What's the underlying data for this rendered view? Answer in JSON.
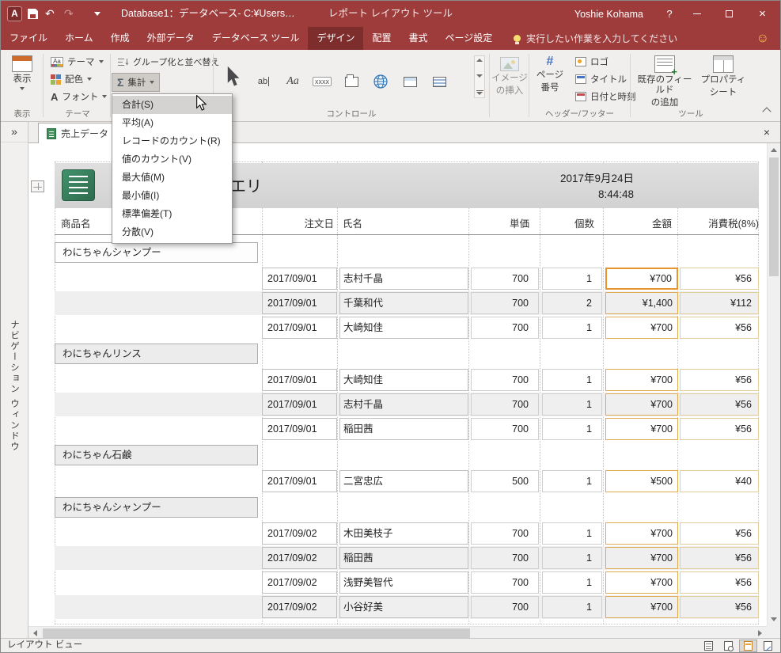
{
  "titlebar": {
    "app_title": "Database1：データベース- C:¥Users…",
    "context_title": "レポート レイアウト ツール",
    "user_name": "Yoshie Kohama",
    "help_label": "?"
  },
  "tabs": {
    "items": [
      {
        "label": "ファイル"
      },
      {
        "label": "ホーム"
      },
      {
        "label": "作成"
      },
      {
        "label": "外部データ"
      },
      {
        "label": "データベース ツール"
      },
      {
        "label": "デザイン",
        "active": true
      },
      {
        "label": "配置"
      },
      {
        "label": "書式"
      },
      {
        "label": "ページ設定"
      }
    ],
    "tell_me": "実行したい作業を入力してください"
  },
  "ribbon": {
    "view_button": "表示",
    "view_group_label": "表示",
    "theme_button": "テーマ",
    "colors_button": "配色",
    "fonts_button": "フォント",
    "theme_group_label": "テーマ",
    "group_sort_button": "グループ化と並べ替え",
    "totals_button": "集計",
    "controls_group_label": "コントロール",
    "image_line1": "イメージ",
    "image_line2": "の挿入",
    "page_number_line1": "ページ",
    "page_number_line2": "番号",
    "logo_button": "ロゴ",
    "title_button": "タイトル",
    "datetime_button": "日付と時刻",
    "header_footer_group_label": "ヘッダー/フッター",
    "add_fields_line1": "既存のフィールド",
    "add_fields_line2": "の追加",
    "property_line1": "プロパティ",
    "property_line2": "シート",
    "tools_group_label": "ツール"
  },
  "totals_menu": {
    "items": [
      {
        "label": "合計(S)",
        "highlighted": true
      },
      {
        "label": "平均(A)"
      },
      {
        "label": "レコードのカウント(R)"
      },
      {
        "label": "値のカウント(V)"
      },
      {
        "label": "最大値(M)"
      },
      {
        "label": "最小値(I)"
      },
      {
        "label": "標準偏差(T)"
      },
      {
        "label": "分散(V)"
      }
    ]
  },
  "nav_pane": {
    "title": "ナビゲーション ウィンドウ"
  },
  "document": {
    "tab_label": "売上データ ク"
  },
  "report": {
    "title_visible_part": "エリ",
    "date": "2017年9月24日",
    "time": "8:44:48",
    "columns": [
      "商品名",
      "注文日",
      "氏名",
      "単価",
      "個数",
      "金額",
      "消費税(8%)"
    ],
    "groups": [
      {
        "product": "わにちゃんシャンプー",
        "shaded": false,
        "rows": [
          {
            "date": "2017/09/01",
            "name": "志村千晶",
            "price": "700",
            "qty": "1",
            "amount": "¥700",
            "tax": "¥56",
            "shaded": false,
            "selected": true
          },
          {
            "date": "2017/09/01",
            "name": "千葉和代",
            "price": "700",
            "qty": "2",
            "amount": "¥1,400",
            "tax": "¥112",
            "shaded": true
          },
          {
            "date": "2017/09/01",
            "name": "大崎知佳",
            "price": "700",
            "qty": "1",
            "amount": "¥700",
            "tax": "¥56",
            "shaded": false
          }
        ]
      },
      {
        "product": "わにちゃんリンス",
        "shaded": true,
        "rows": [
          {
            "date": "2017/09/01",
            "name": "大崎知佳",
            "price": "700",
            "qty": "1",
            "amount": "¥700",
            "tax": "¥56",
            "shaded": false
          },
          {
            "date": "2017/09/01",
            "name": "志村千晶",
            "price": "700",
            "qty": "1",
            "amount": "¥700",
            "tax": "¥56",
            "shaded": true
          },
          {
            "date": "2017/09/01",
            "name": "稲田茜",
            "price": "700",
            "qty": "1",
            "amount": "¥700",
            "tax": "¥56",
            "shaded": false
          }
        ]
      },
      {
        "product": "わにちゃん石鹸",
        "shaded": true,
        "rows": [
          {
            "date": "2017/09/01",
            "name": "二宮忠広",
            "price": "500",
            "qty": "1",
            "amount": "¥500",
            "tax": "¥40",
            "shaded": false
          }
        ]
      },
      {
        "product": "わにちゃんシャンプー",
        "shaded": true,
        "rows": [
          {
            "date": "2017/09/02",
            "name": "木田美枝子",
            "price": "700",
            "qty": "1",
            "amount": "¥700",
            "tax": "¥56",
            "shaded": false
          },
          {
            "date": "2017/09/02",
            "name": "稲田茜",
            "price": "700",
            "qty": "1",
            "amount": "¥700",
            "tax": "¥56",
            "shaded": true
          },
          {
            "date": "2017/09/02",
            "name": "浅野美智代",
            "price": "700",
            "qty": "1",
            "amount": "¥700",
            "tax": "¥56",
            "shaded": false
          },
          {
            "date": "2017/09/02",
            "name": "小谷好美",
            "price": "700",
            "qty": "1",
            "amount": "¥700",
            "tax": "¥56",
            "shaded": true
          }
        ]
      }
    ]
  },
  "statusbar": {
    "view_label": "レイアウト ビュー"
  },
  "glyphs": {
    "app_initial": "A",
    "undo": "↶",
    "redo": "↷",
    "expand": "»",
    "close": "×",
    "smiley": "☺",
    "sigma": "Σ",
    "textbox_icon": "ab",
    "label_icon": "Aa",
    "button_icon": "xxxx",
    "hash_icon": "#"
  }
}
